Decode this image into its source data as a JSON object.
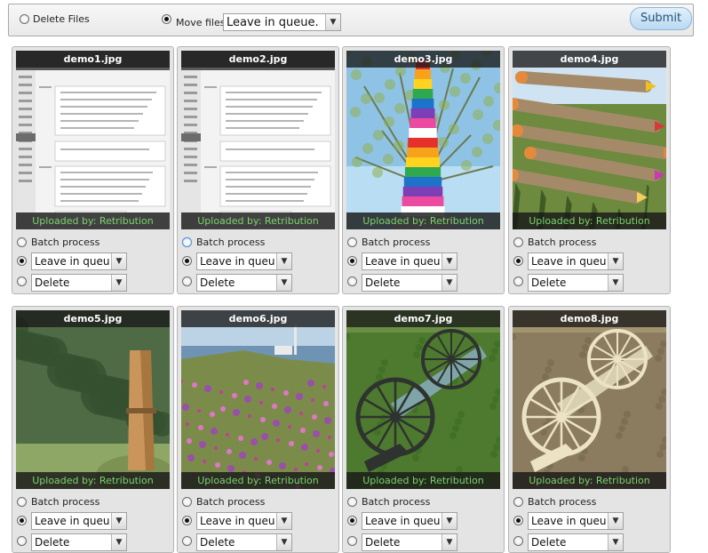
{
  "toolbar": {
    "delete_files_label": "Delete Files",
    "delete_files_checked": false,
    "move_files_label": "Move files",
    "move_files_checked": true,
    "move_target_value": "Leave in queue.",
    "submit_label": "Submit"
  },
  "gallery": {
    "cards": [
      {
        "filename": "demo1.jpg",
        "uploader": "Uploaded by: Retribution",
        "image": "admin-screenshot",
        "batch_label": "Batch process",
        "batch_checked": false,
        "action_a_checked": true,
        "action_a_value": "Leave in queue",
        "action_b_checked": false,
        "action_b_value": "Delete"
      },
      {
        "filename": "demo2.jpg",
        "uploader": "Uploaded by: Retribution",
        "image": "admin-screenshot",
        "batch_label": "Batch process",
        "batch_checked": false,
        "action_a_checked": true,
        "action_a_value": "Leave in queue",
        "action_b_checked": false,
        "action_b_value": "Delete"
      },
      {
        "filename": "demo3.jpg",
        "uploader": "Uploaded by: Retribution",
        "image": "yarn-bombed-tree",
        "batch_label": "Batch process",
        "batch_checked": false,
        "action_a_checked": true,
        "action_a_value": "Leave in queue",
        "action_b_checked": false,
        "action_b_value": "Delete"
      },
      {
        "filename": "demo4.jpg",
        "uploader": "Uploaded by: Retribution",
        "image": "pencil-logs",
        "batch_label": "Batch process",
        "batch_checked": false,
        "action_a_checked": true,
        "action_a_value": "Leave in queue",
        "action_b_checked": false,
        "action_b_value": "Delete"
      },
      {
        "filename": "demo5.jpg",
        "uploader": "Uploaded by: Retribution",
        "image": "giant-clothespin",
        "batch_label": "Batch process",
        "batch_checked": false,
        "action_a_checked": true,
        "action_a_value": "Leave in queue",
        "action_b_checked": false,
        "action_b_value": "Delete"
      },
      {
        "filename": "demo6.jpg",
        "uploader": "Uploaded by: Retribution",
        "image": "coastal-flowers",
        "batch_label": "Batch process",
        "batch_checked": false,
        "action_a_checked": true,
        "action_a_value": "Leave in queue",
        "action_b_checked": false,
        "action_b_value": "Delete"
      },
      {
        "filename": "demo7.jpg",
        "uploader": "Uploaded by: Retribution",
        "image": "cannon",
        "batch_label": "Batch process",
        "batch_checked": false,
        "action_a_checked": true,
        "action_a_value": "Leave in queue",
        "action_b_checked": false,
        "action_b_value": "Delete"
      },
      {
        "filename": "demo8.jpg",
        "uploader": "Uploaded by: Retribution",
        "image": "cannon-sepia",
        "batch_label": "Batch process",
        "batch_checked": false,
        "action_a_checked": true,
        "action_a_value": "Leave in queue",
        "action_b_checked": false,
        "action_b_value": "Delete"
      }
    ]
  },
  "icons": {
    "dropdown_arrow": "chevron-down-icon",
    "radio": "radio-icon"
  }
}
